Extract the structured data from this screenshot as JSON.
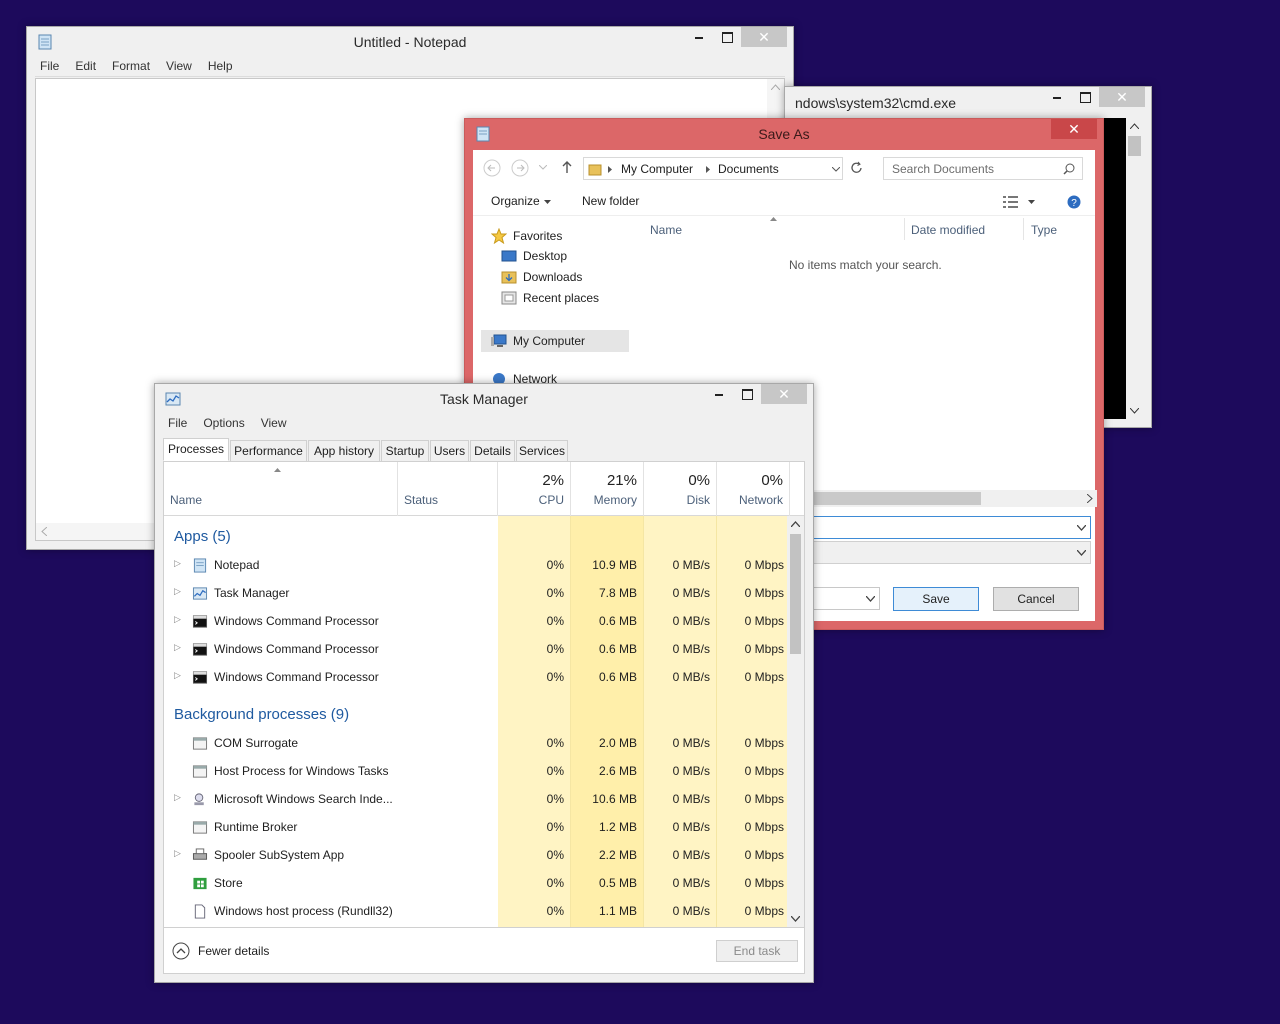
{
  "notepad": {
    "title": "Untitled - Notepad",
    "menu": [
      "File",
      "Edit",
      "Format",
      "View",
      "Help"
    ]
  },
  "cmd": {
    "title": "ndows\\system32\\cmd.exe"
  },
  "saveas": {
    "title": "Save As",
    "breadcrumb": [
      "My Computer",
      "Documents"
    ],
    "search_placeholder": "Search Documents",
    "organize_label": "Organize",
    "new_folder_label": "New folder",
    "nav": {
      "favorites": "Favorites",
      "desktop": "Desktop",
      "downloads": "Downloads",
      "recent": "Recent places",
      "my_computer": "My Computer",
      "network": "Network"
    },
    "columns": [
      "Name",
      "Date modified",
      "Type"
    ],
    "empty_message": "No items match your search.",
    "save_label": "Save",
    "cancel_label": "Cancel"
  },
  "taskman": {
    "title": "Task Manager",
    "menu": [
      "File",
      "Options",
      "View"
    ],
    "tabs": [
      "Processes",
      "Performance",
      "App history",
      "Startup",
      "Users",
      "Details",
      "Services"
    ],
    "headers": {
      "name": "Name",
      "status": "Status",
      "cpu_pct": "2%",
      "cpu": "CPU",
      "mem_pct": "21%",
      "mem": "Memory",
      "disk_pct": "0%",
      "disk": "Disk",
      "net_pct": "0%",
      "net": "Network"
    },
    "apps_group": "Apps (5)",
    "bg_group": "Background processes (9)",
    "apps": [
      {
        "name": "Notepad",
        "cpu": "0%",
        "mem": "10.9 MB",
        "disk": "0 MB/s",
        "net": "0 Mbps"
      },
      {
        "name": "Task Manager",
        "cpu": "0%",
        "mem": "7.8 MB",
        "disk": "0 MB/s",
        "net": "0 Mbps"
      },
      {
        "name": "Windows Command Processor",
        "cpu": "0%",
        "mem": "0.6 MB",
        "disk": "0 MB/s",
        "net": "0 Mbps"
      },
      {
        "name": "Windows Command Processor",
        "cpu": "0%",
        "mem": "0.6 MB",
        "disk": "0 MB/s",
        "net": "0 Mbps"
      },
      {
        "name": "Windows Command Processor",
        "cpu": "0%",
        "mem": "0.6 MB",
        "disk": "0 MB/s",
        "net": "0 Mbps"
      }
    ],
    "background": [
      {
        "name": "COM Surrogate",
        "cpu": "0%",
        "mem": "2.0 MB",
        "disk": "0 MB/s",
        "net": "0 Mbps"
      },
      {
        "name": "Host Process for Windows Tasks",
        "cpu": "0%",
        "mem": "2.6 MB",
        "disk": "0 MB/s",
        "net": "0 Mbps"
      },
      {
        "name": "Microsoft Windows Search Inde...",
        "cpu": "0%",
        "mem": "10.6 MB",
        "disk": "0 MB/s",
        "net": "0 Mbps"
      },
      {
        "name": "Runtime Broker",
        "cpu": "0%",
        "mem": "1.2 MB",
        "disk": "0 MB/s",
        "net": "0 Mbps"
      },
      {
        "name": "Spooler SubSystem App",
        "cpu": "0%",
        "mem": "2.2 MB",
        "disk": "0 MB/s",
        "net": "0 Mbps"
      },
      {
        "name": "Store",
        "cpu": "0%",
        "mem": "0.5 MB",
        "disk": "0 MB/s",
        "net": "0 Mbps"
      },
      {
        "name": "Windows host process (Rundll32)",
        "cpu": "0%",
        "mem": "1.1 MB",
        "disk": "0 MB/s",
        "net": "0 Mbps"
      }
    ],
    "fewer_details": "Fewer details",
    "end_task": "End task"
  },
  "colors": {
    "desktop": "#1d0a5c",
    "saveas_frame": "#dc6768",
    "group_text": "#1f5aa0",
    "heat_cell": "#fff4c4"
  }
}
